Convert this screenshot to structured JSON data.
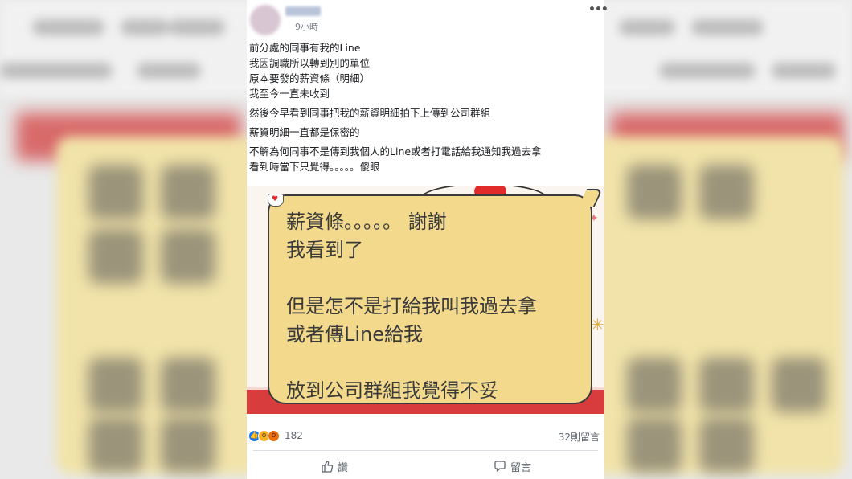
{
  "post": {
    "time": "9小時",
    "more_icon": "more-horizontal-icon",
    "lines": [
      "前分處的同事有我的Line",
      "我因調職所以轉到別的單位",
      "原本要發的薪資條（明細）",
      "我至今一直未收到",
      "然後今早看到同事把我的薪資明細拍下上傳到公司群組",
      "薪資明細一直都是保密的",
      "不解為何同事不是傳到我個人的Line或者打電話給我通知我過去拿",
      "看到時當下只覺得。。。。。傻眼"
    ]
  },
  "image": {
    "bubble_lines": [
      "薪資條。。。。。 謝謝",
      "我看到了",
      "但是怎不是打給我叫我過去拿",
      "或者傳Line給我",
      "放到公司群組我覺得不妥"
    ],
    "colors": {
      "bubble": "#f2d98c",
      "stripe": "#d93c3c"
    }
  },
  "footer": {
    "reaction_icons": [
      "like-icon",
      "wow-icon",
      "angry-icon"
    ],
    "reaction_count": "182",
    "comment_count": "32則留言",
    "like_label": "讚",
    "comment_label": "留言"
  }
}
